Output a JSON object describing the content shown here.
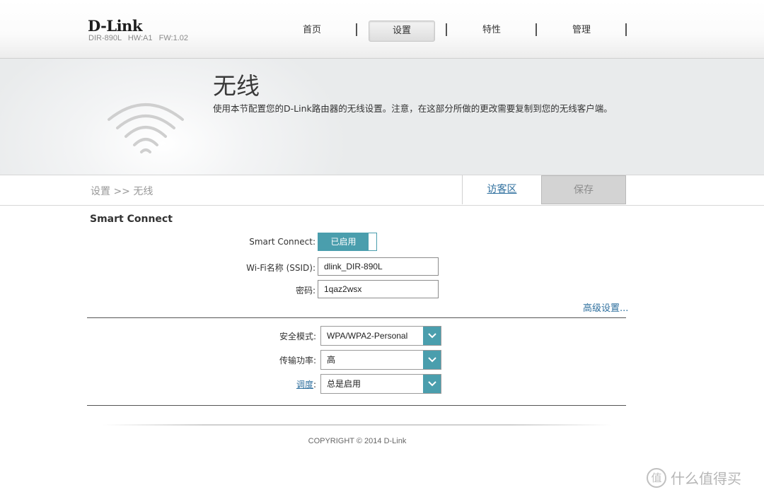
{
  "brand": {
    "logo": "D-Link",
    "model": "DIR-890L   HW:A1   FW:1.02"
  },
  "nav": {
    "items": [
      "首页",
      "设置",
      "特性",
      "管理"
    ],
    "active": "设置"
  },
  "hero": {
    "title": "无线",
    "description": "使用本节配置您的D-Link路由器的无线设置。注意，在这部分所做的更改需要复制到您的无线客户端。"
  },
  "breadcrumb": "设置 >> 无线",
  "actions": {
    "guest_zone": "访客区",
    "save": "保存"
  },
  "smart_connect": {
    "section_title": "Smart Connect",
    "toggle_label": "Smart Connect:",
    "toggle_state": "已启用",
    "ssid_label": "Wi-Fi名称 (SSID):",
    "ssid_value": "dlink_DIR-890L",
    "password_label": "密码:",
    "password_value": "1qaz2wsx",
    "advanced_link": "高级设置..."
  },
  "advanced": {
    "security_label": "安全模式:",
    "security_value": "WPA/WPA2-Personal",
    "power_label": "传输功率:",
    "power_value": "高",
    "schedule_label": "调度",
    "schedule_colon": ":",
    "schedule_value": "总是启用"
  },
  "footer": {
    "copyright": "COPYRIGHT © 2014 D-Link"
  },
  "watermark": {
    "symbol": "值",
    "text": "什么值得买"
  },
  "colors": {
    "accent": "#4a9ead",
    "link": "#2e6f9e",
    "save_bg": "#d3d3d3"
  }
}
